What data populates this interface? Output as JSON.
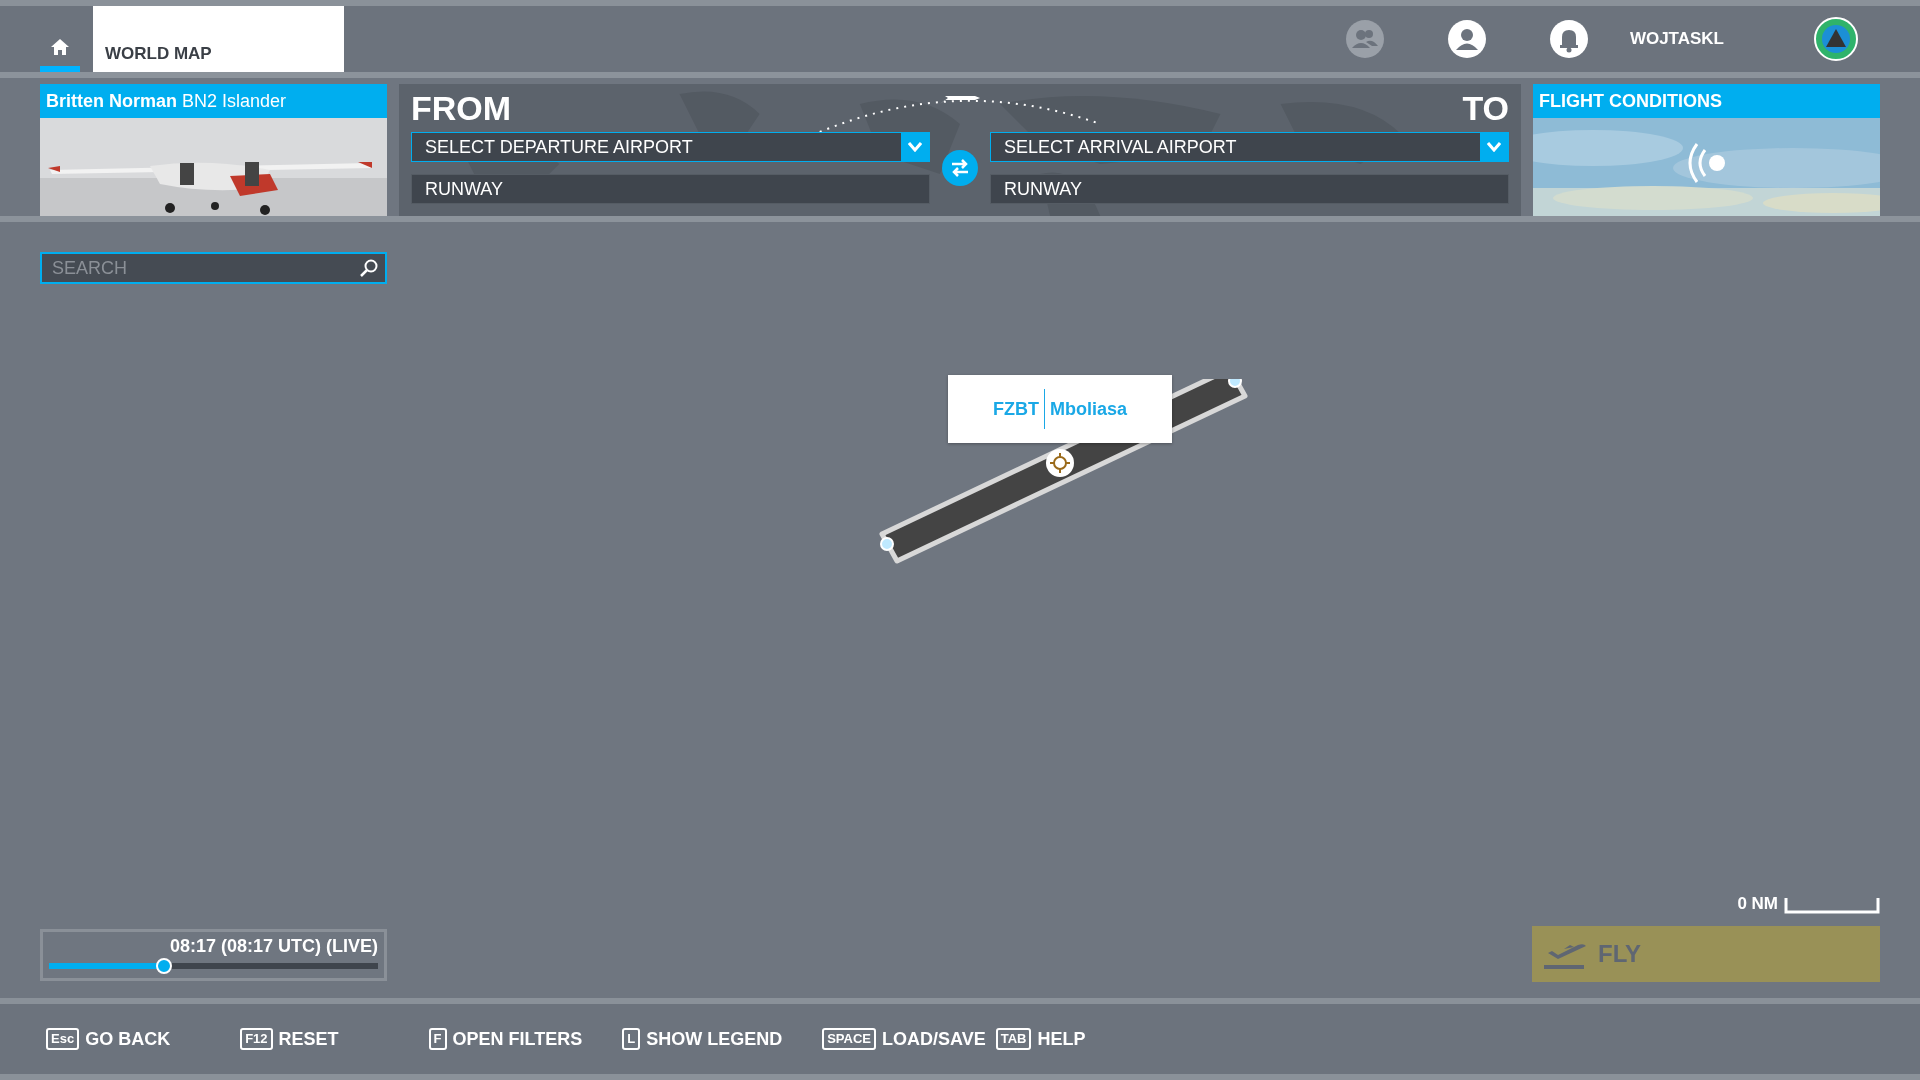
{
  "top_bar": {
    "tabs": [
      {
        "kind": "home",
        "selected": true
      },
      {
        "kind": "text",
        "label": "WORLD MAP",
        "selected": true
      }
    ],
    "username": "WOJTASKL"
  },
  "aircraft": {
    "name": "**Britten Norman** BN2 Islander"
  },
  "route": {
    "from_label": "FROM",
    "to_label": "TO",
    "departure": {
      "airport": "SELECT DEPARTURE AIRPORT",
      "runway": "RUNWAY"
    },
    "arrival": {
      "airport": "SELECT ARRIVAL AIRPORT",
      "runway": "RUNWAY"
    }
  },
  "flight_conditions": {
    "title": "FLIGHT CONDITIONS"
  },
  "search": {
    "placeholder": "SEARCH"
  },
  "map": {
    "airport": {
      "icao": "FZBT",
      "name": "Mboliasa"
    },
    "scale": "0 NM"
  },
  "time": {
    "text": "08:17 (08:17 UTC) (LIVE)",
    "level": 0.35
  },
  "fly_button": {
    "label": "FLY",
    "disabled": true
  },
  "hints": [
    {
      "key": "Esc",
      "label": "GO BACK"
    },
    {
      "key": "F12",
      "label": "RESET"
    },
    {
      "key": "F",
      "label": "OPEN FILTERS"
    },
    {
      "key": "L",
      "label": "SHOW LEGEND"
    },
    {
      "key": "SPACE",
      "label": "LOAD/SAVE"
    },
    {
      "key": "TAB",
      "label": "HELP"
    }
  ]
}
